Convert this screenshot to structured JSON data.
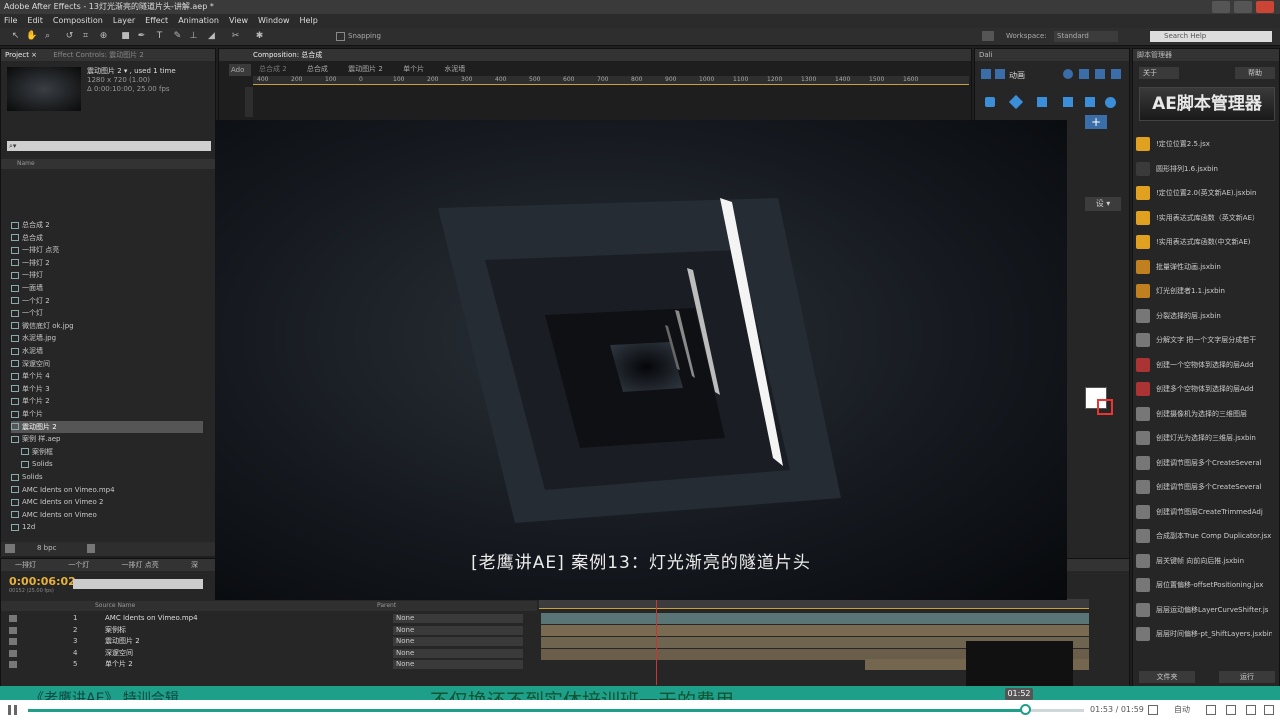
{
  "titlebar": {
    "title": "Adobe After Effects - 13灯光渐亮的隧道片头-讲解.aep *"
  },
  "menu": [
    "File",
    "Edit",
    "Composition",
    "Layer",
    "Effect",
    "Animation",
    "View",
    "Window",
    "Help"
  ],
  "toolbar": {
    "snapping": "Snapping",
    "workspace_label": "Workspace:",
    "workspace_value": "Standard",
    "search": "Search Help"
  },
  "project": {
    "tabs": [
      "Project ×",
      "Effect Controls: 震动图片 2"
    ],
    "item_name": "震动图片 2 ▾ , used 1 time",
    "item_size": "1280 x 720 (1.00)",
    "item_dur": "Δ 0:00:10:00, 25.00 fps",
    "search_placeholder": "",
    "col_name": "Name",
    "items": [
      "总合成 2",
      "总合成",
      "一排灯 点亮",
      "一排灯 2",
      "一排灯",
      "一面墙",
      "一个灯 2",
      "一个灯",
      "微信底灯 ok.jpg",
      "水泥墙.jpg",
      "水泥墙",
      "深邃空间",
      "单个片 4",
      "单个片 3",
      "单个片 2",
      "单个片",
      "震动图片 2",
      "案例 样.aep",
      "案例框",
      "Solids",
      "Solids",
      "AMC Idents on Vimeo.mp4",
      "AMC Idents on Vimeo 2",
      "AMC Idents on Vimeo",
      "12d"
    ],
    "bpc": "8 bpc"
  },
  "composition": {
    "tab": "Composition: 总合成",
    "crumbs": [
      "总合成 2",
      "总合成",
      "震动图片 2",
      "单个片",
      "水泥墙"
    ],
    "ruler": [
      "400",
      "200",
      "100",
      "0",
      "100",
      "200",
      "300",
      "400",
      "500",
      "600",
      "700",
      "800",
      "900",
      "1000",
      "1100",
      "1200",
      "1300",
      "1400",
      "1500",
      "1600"
    ]
  },
  "right_panel": {
    "tab": "Dali",
    "anim": "动画",
    "settings": "设 ▾"
  },
  "scripts": {
    "tab": "脚本管理器",
    "about": "关于",
    "help": "帮助",
    "logo": "AE脚本管理器",
    "items": [
      "!定位位置2.5.jsx",
      "圆形排列1.6.jsxbin",
      "!定位位置2.0(英文新AE).jsxbin",
      "!实用表达式库函数（英文新AE）",
      "!实用表达式库函数(中文新AE)",
      "批量弹性动画.jsxbin",
      "灯光创建者1.1.jsxbin",
      "分裂选择的层.jsxbin",
      "分解文字 把一个文字层分成若干",
      "创建一个空物体到选择的层Add",
      "创建多个空物体到选择的层Add",
      "创建摄像机为选择的三维图层",
      "创建灯光为选择的三维层.jsxbin",
      "创建调节图层多个CreateSeveral",
      "创建调节图层多个CreateSeveral",
      "创建调节图层CreateTrimmedAdj",
      "合成副本True Comp Duplicator.jsx",
      "层关键帧 向前向后推.jsxbin",
      "层位置偏移-offsetPositioning.jsx",
      "层层运动偏移LayerCurveShifter.js",
      "层层时间偏移-pt_ShiftLayers.jsxbin"
    ],
    "files": "文件夹",
    "run": "运行"
  },
  "timeline": {
    "tabs": [
      "一排灯",
      "一个灯",
      "一排灯 点亮",
      "深"
    ],
    "timecode": "0:00:06:02",
    "fps": "00152 (25.00 fps)",
    "col_source": "Source Name",
    "col_parent": "Parent",
    "layers": [
      {
        "num": "1",
        "name": "AMC Idents on Vimeo.mp4",
        "parent": "None"
      },
      {
        "num": "2",
        "name": "案例标",
        "parent": "None"
      },
      {
        "num": "3",
        "name": "震动图片 2",
        "parent": "None"
      },
      {
        "num": "4",
        "name": "深邃空间",
        "parent": "None"
      },
      {
        "num": "5",
        "name": "单个片 2",
        "parent": "None"
      }
    ]
  },
  "video": {
    "subtitle": "[老鹰讲AE] 案例13：灯光渐亮的隧道片头"
  },
  "player": {
    "big_title_left": "《老鹰讲AE》 特训合辑",
    "big_title": "不仅换还不到实体培训班一天的费用",
    "current": "01:53",
    "total": "01:59",
    "tooltip": "01:52",
    "progress": 0.944,
    "quality": "自动",
    "colors": {
      "accent": "#1d9f8a"
    }
  }
}
